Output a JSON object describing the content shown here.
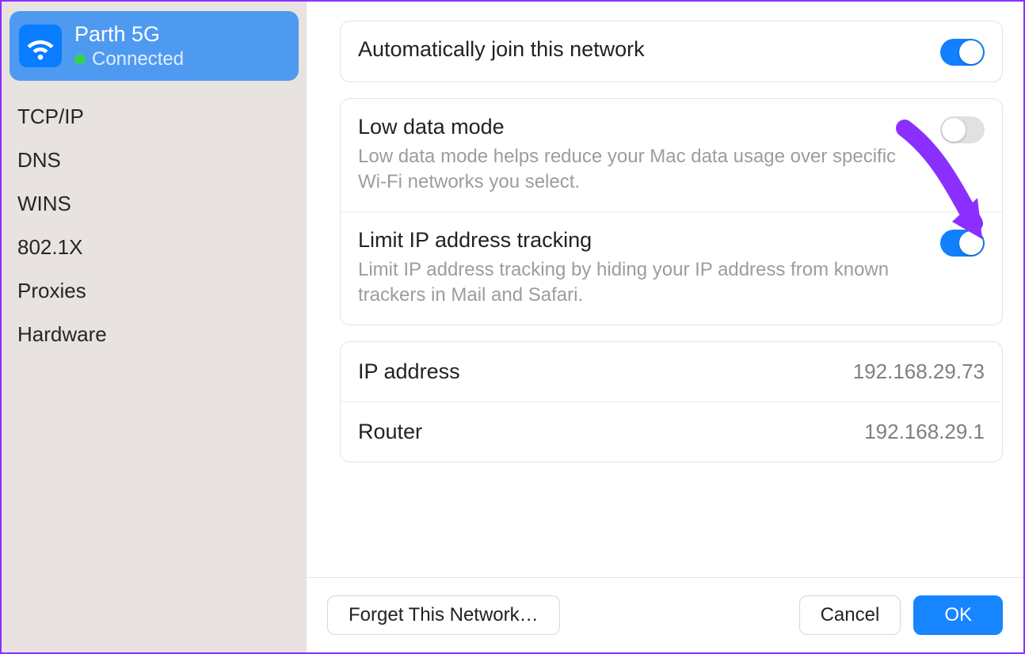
{
  "sidebar": {
    "network": {
      "name": "Parth 5G",
      "status": "Connected"
    },
    "items": [
      {
        "label": "TCP/IP"
      },
      {
        "label": "DNS"
      },
      {
        "label": "WINS"
      },
      {
        "label": "802.1X"
      },
      {
        "label": "Proxies"
      },
      {
        "label": "Hardware"
      }
    ]
  },
  "settings": {
    "auto_join": {
      "title": "Automatically join this network",
      "on": true
    },
    "low_data": {
      "title": "Low data mode",
      "desc": "Low data mode helps reduce your Mac data usage over specific Wi-Fi networks you select.",
      "on": false
    },
    "limit_ip": {
      "title": "Limit IP address tracking",
      "desc": "Limit IP address tracking by hiding your IP address from known trackers in Mail and Safari.",
      "on": true
    },
    "ip_address": {
      "label": "IP address",
      "value": "192.168.29.73"
    },
    "router": {
      "label": "Router",
      "value": "192.168.29.1"
    }
  },
  "footer": {
    "forget": "Forget This Network…",
    "cancel": "Cancel",
    "ok": "OK"
  },
  "colors": {
    "accent": "#1180ff",
    "annotation": "#8930ff"
  }
}
